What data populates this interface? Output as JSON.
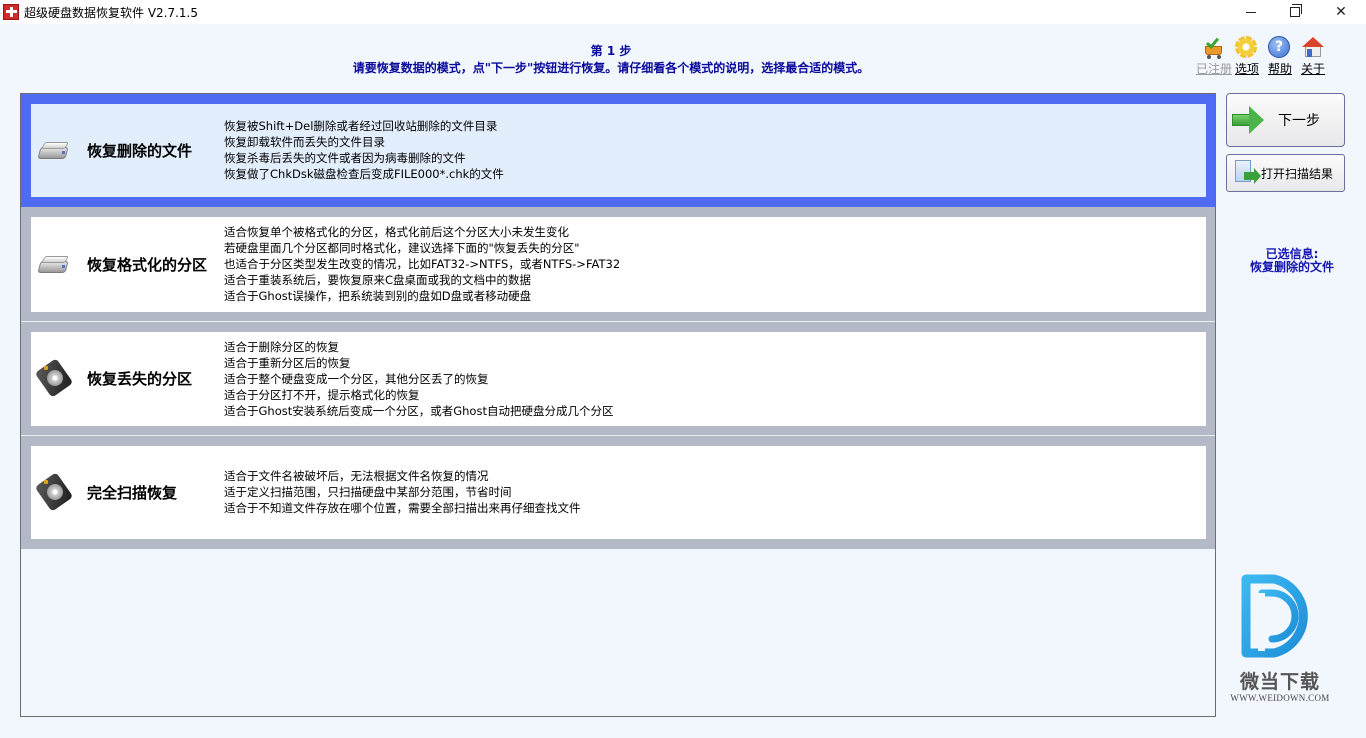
{
  "window": {
    "title": "超级硬盘数据恢复软件 V2.7.1.5",
    "minimize_icon": "minimize-icon",
    "maximize_icon": "restore-icon",
    "close_icon": "close-icon"
  },
  "header": {
    "step": "第 1 步",
    "instruction": "请要恢复数据的模式，点\"下一步\"按钮进行恢复。请仔细看各个模式的说明，选择最合适的模式。"
  },
  "toolbar": {
    "items": [
      {
        "label": "已注册",
        "icon": "shopping-cart-check-icon",
        "disabled": true
      },
      {
        "label": "选项",
        "icon": "gear-icon",
        "disabled": false
      },
      {
        "label": "帮助",
        "icon": "help-icon",
        "disabled": false
      },
      {
        "label": "关于",
        "icon": "home-icon",
        "disabled": false
      }
    ]
  },
  "modes": [
    {
      "name": "恢复删除的文件",
      "icon": "drive-icon",
      "selected": true,
      "description": [
        "恢复被Shift+Del删除或者经过回收站删除的文件目录",
        "恢复卸载软件而丢失的文件目录",
        "恢复杀毒后丢失的文件或者因为病毒删除的文件",
        "恢复做了ChkDsk磁盘检查后变成FILE000*.chk的文件"
      ]
    },
    {
      "name": "恢复格式化的分区",
      "icon": "drive-icon",
      "selected": false,
      "description": [
        "适合恢复单个被格式化的分区，格式化前后这个分区大小未发生变化",
        "若硬盘里面几个分区都同时格式化，建议选择下面的\"恢复丢失的分区\"",
        "也适合于分区类型发生改变的情况，比如FAT32->NTFS，或者NTFS->FAT32",
        "适合于重装系统后，要恢复原来C盘桌面或我的文档中的数据",
        "适合于Ghost误操作，把系统装到别的盘如D盘或者移动硬盘"
      ]
    },
    {
      "name": "恢复丢失的分区",
      "icon": "hard-disk-icon",
      "selected": false,
      "description": [
        "适合于删除分区的恢复",
        "适合于重新分区后的恢复",
        "适合于整个硬盘变成一个分区，其他分区丢了的恢复",
        "适合于分区打不开，提示格式化的恢复",
        "适合于Ghost安装系统后变成一个分区，或者Ghost自动把硬盘分成几个分区"
      ]
    },
    {
      "name": "完全扫描恢复",
      "icon": "hard-disk-icon",
      "selected": false,
      "description": [
        "适合于文件名被破坏后，无法根据文件名恢复的情况",
        "适于定义扫描范围，只扫描硬盘中某部分范围，节省时间",
        "适合于不知道文件存放在哪个位置，需要全部扫描出来再仔细查找文件"
      ]
    }
  ],
  "actions": {
    "next_label": "下一步",
    "next_icon": "green-arrow-right-icon",
    "open_results_label": "打开扫描结果",
    "open_results_icon": "open-file-icon"
  },
  "selection": {
    "label": "已选信息:",
    "value": "恢复删除的文件"
  },
  "logo": {
    "name": "微当下载",
    "url": "WWW.WEIDOWN.COM"
  },
  "colors": {
    "selected_border": "#4e6bf2",
    "selected_bg": "#e2eefc",
    "item_border": "#b3b9c7",
    "header_text": "#0a0a9a",
    "info_text": "#1616b0",
    "logo_blue": "#2aa0e6"
  }
}
